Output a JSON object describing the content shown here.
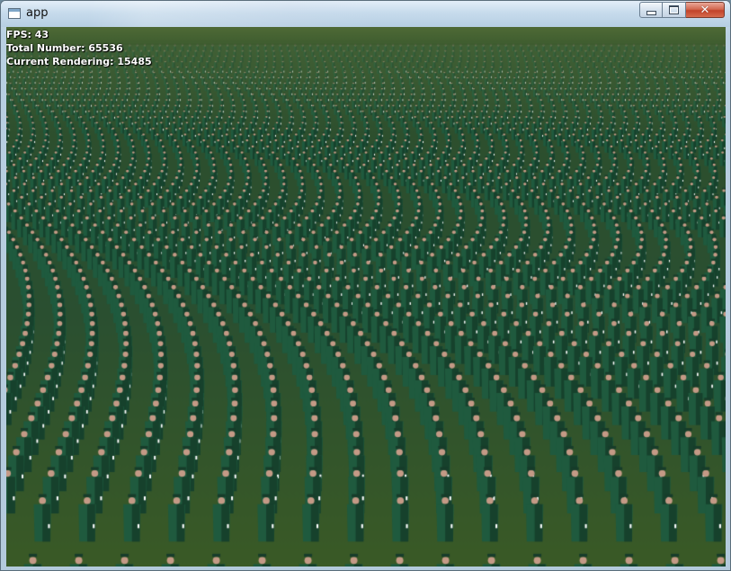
{
  "window": {
    "title": "app",
    "icon": "app-window-icon",
    "controls": [
      "minimize",
      "maximize",
      "close"
    ],
    "close_glyph": "✕"
  },
  "hud": {
    "fps_label": "FPS: 43",
    "total_label": "Total Number: 65536",
    "current_label": "Current Rendering: 15485"
  },
  "scene": {
    "description_kind": "3d-crowd-render",
    "sky_color": "#546b3e",
    "ground_color": "#2f5a33",
    "figure_body_color": "#1f5a3e",
    "figure_face_color": "#c49a86",
    "figure_highlight_color": "#ffffff"
  }
}
